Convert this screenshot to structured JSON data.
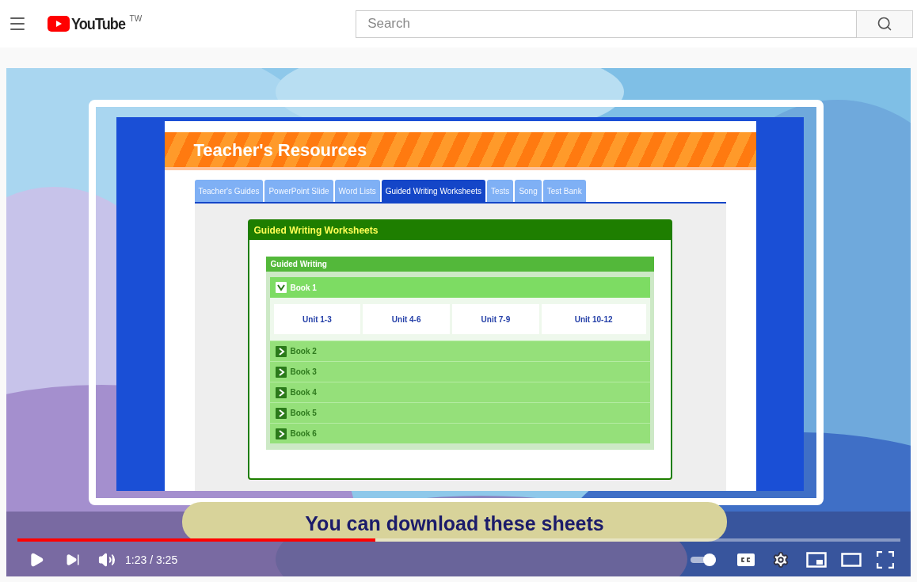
{
  "header": {
    "logo": "YouTube",
    "region": "TW",
    "search": {
      "placeholder": "Search"
    }
  },
  "video": {
    "screen": {
      "title": "Teacher's Resources",
      "tabs": [
        {
          "label": "Teacher's Guides",
          "selected": false
        },
        {
          "label": "PowerPoint Slide",
          "selected": false
        },
        {
          "label": "Word Lists",
          "selected": false
        },
        {
          "label": "Guided Writing Worksheets",
          "selected": true
        },
        {
          "label": "Tests",
          "selected": false
        },
        {
          "label": "Song",
          "selected": false
        },
        {
          "label": "Test Bank",
          "selected": false
        }
      ],
      "card": {
        "title": "Guided Writing Worksheets",
        "section": "Guided Writing",
        "books": [
          {
            "label": "Book 1",
            "expanded": true,
            "units": [
              "Unit 1-3",
              "Unit 4-6",
              "Unit 7-9",
              "Unit 10-12"
            ]
          },
          {
            "label": "Book 2",
            "expanded": false
          },
          {
            "label": "Book 3",
            "expanded": false
          },
          {
            "label": "Book 4",
            "expanded": false
          },
          {
            "label": "Book 5",
            "expanded": false
          },
          {
            "label": "Book 6",
            "expanded": false
          }
        ]
      }
    },
    "caption": "You can download these sheets",
    "player": {
      "progress": {
        "level": 0.405
      },
      "time": "1:23 / 3:25",
      "autoplay": {
        "on": true
      }
    }
  }
}
